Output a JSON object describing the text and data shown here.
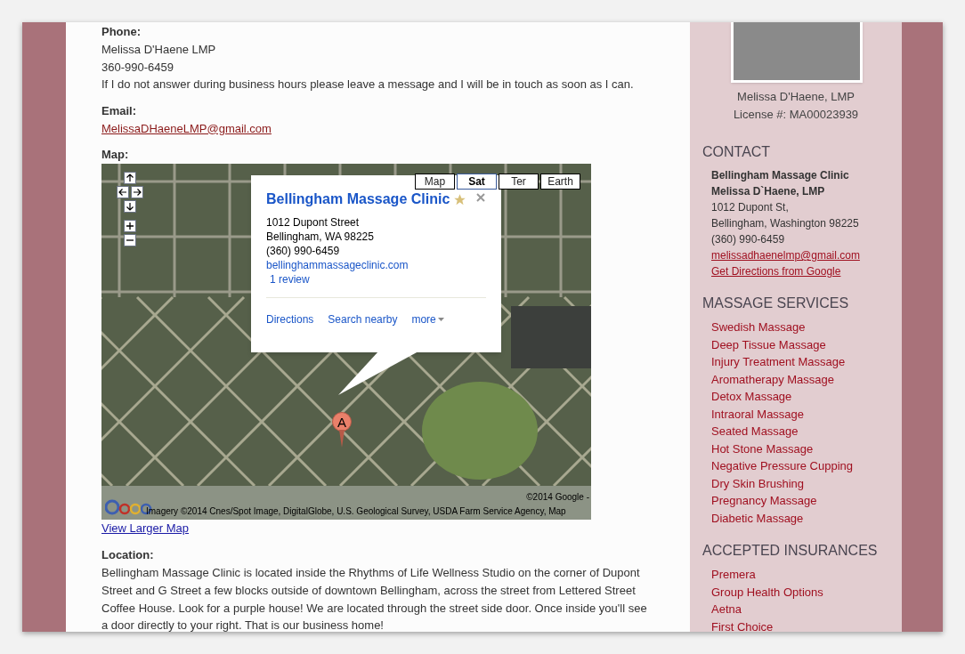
{
  "main": {
    "phone": {
      "label": "Phone:",
      "lines": [
        "Melissa D'Haene LMP",
        "360-990-6459",
        "If I do not answer during business hours please leave a message and I will be in touch as soon as I can."
      ]
    },
    "email": {
      "label": "Email:",
      "link": "MelissaDHaeneLMP@gmail.com"
    },
    "map": {
      "label": "Map:",
      "map_types": [
        {
          "label": "Map",
          "selected": false
        },
        {
          "label": "Sat",
          "selected": true
        },
        {
          "label": "Ter",
          "selected": false
        },
        {
          "label": "Earth",
          "selected": false
        }
      ],
      "info_window": {
        "title": "Bellingham Massage Clinic",
        "address": [
          "1012 Dupont Street",
          "Bellingham, WA 98225",
          "(360) 990-6459"
        ],
        "website": "bellinghammassageclinic.com",
        "reviews": "1 review",
        "actions": [
          "Directions",
          "Search nearby",
          "more"
        ]
      },
      "marker": "A",
      "copyright": "©2014 Google -",
      "imagery": "Imagery ©2014 Cnes/Spot Image, DigitalGlobe, U.S. Geological Survey, USDA Farm Service Agency, Map",
      "larger_link": "View Larger Map"
    },
    "location": {
      "label": "Location:",
      "text": "Bellingham Massage Clinic is located inside the Rhythms of Life Wellness Studio on the corner of Dupont Street and G Street a few blocks outside of downtown Bellingham, across the street from Lettered Street Coffee House. Look for a purple house! We are located through the street side door. Once inside you'll see a door directly to your right. That is our business home!"
    }
  },
  "sidebar": {
    "caption": [
      "Melissa D'Haene, LMP",
      "License #: MA00023939"
    ],
    "contact": {
      "heading": "CONTACT",
      "bold_lines": [
        "Bellingham Massage Clinic",
        "Melissa D`Haene, LMP"
      ],
      "lines": [
        "1012 Dupont St,",
        "Bellingham, Washington 98225",
        "(360) 990-6459"
      ],
      "links": [
        "melissadhaenelmp@gmail.com",
        "Get Directions from Google"
      ]
    },
    "services": {
      "heading": "MASSAGE SERVICES",
      "items": [
        "Swedish Massage",
        "Deep Tissue Massage",
        "Injury Treatment Massage",
        "Aromatherapy Massage",
        "Detox Massage",
        "Intraoral Massage",
        "Seated Massage",
        "Hot Stone Massage",
        "Negative Pressure Cupping",
        "Dry Skin Brushing",
        "Pregnancy Massage",
        "Diabetic Massage"
      ]
    },
    "insurances": {
      "heading": "ACCEPTED INSURANCES",
      "items": [
        "Premera",
        "Group Health Options",
        "Aetna",
        "First Choice"
      ]
    }
  }
}
